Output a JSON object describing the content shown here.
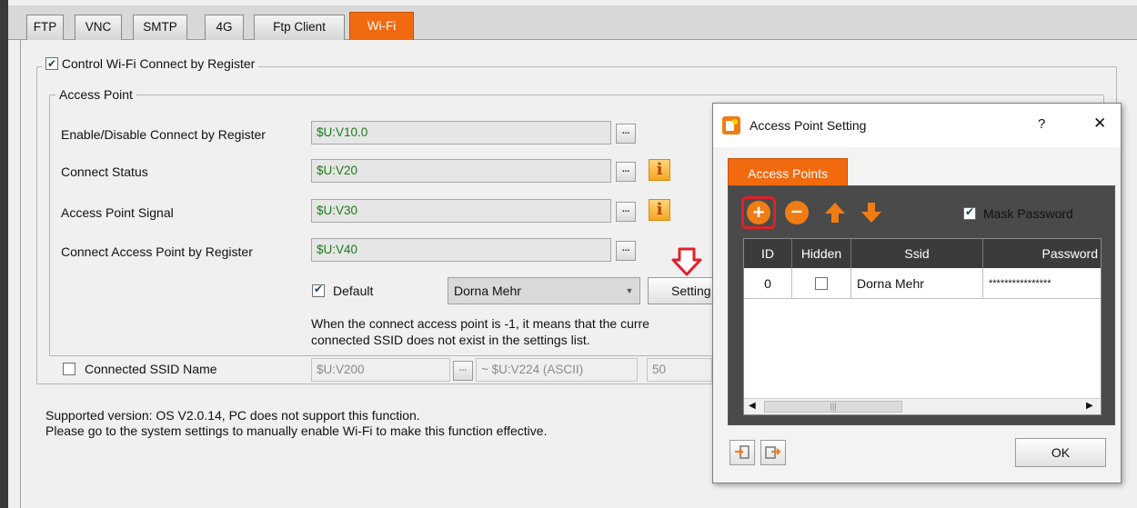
{
  "tabs": [
    "FTP",
    "VNC",
    "SMTP",
    "4G",
    "Ftp Client",
    "Wi-Fi"
  ],
  "active_tab": "Wi-Fi",
  "control_group": {
    "label": "Control Wi-Fi Connect by Register",
    "checked": true
  },
  "access_point_group": {
    "label": "Access Point",
    "rows": [
      {
        "label": "Enable/Disable Connect by Register",
        "value": "$U:V10.0",
        "dots": "...",
        "info": false
      },
      {
        "label": "Connect Status",
        "value": "$U:V20",
        "dots": "...",
        "info": true
      },
      {
        "label": "Access Point Signal",
        "value": "$U:V30",
        "dots": "...",
        "info": true
      },
      {
        "label": "Connect Access Point by Register",
        "value": "$U:V40",
        "dots": "...",
        "info": false
      }
    ],
    "info_glyph": "i",
    "default_label": "Default",
    "default_checked": true,
    "default_select": "Dorna Mehr",
    "settings_button": "Setting",
    "note_line1": "When the connect access point is -1, it means that the curre",
    "note_line2": "connected SSID does not exist in the settings list."
  },
  "connected_ssid": {
    "label": "Connected SSID Name",
    "checked": false,
    "value": "$U:V200",
    "dots": "...",
    "range": "~ $U:V224 (ASCII)",
    "length": "50"
  },
  "footer": {
    "line1": "Supported version: OS V2.0.14, PC does not support this function.",
    "line2": "Please go to the system settings to manually enable Wi-Fi to make this function effective."
  },
  "dialog": {
    "title": "Access Point Setting",
    "help": "?",
    "close": "✕",
    "tab": "Access Points",
    "mask_password_label": "Mask Password",
    "mask_password_checked": true,
    "columns": [
      "ID",
      "Hidden",
      "Ssid",
      "Password"
    ],
    "rows": [
      {
        "id": "0",
        "hidden": false,
        "ssid": "Dorna Mehr",
        "password": "****************"
      }
    ],
    "ok_label": "OK"
  },
  "colors": {
    "accent": "#f26a10",
    "highlight": "#e0202a",
    "value_text": "#1a7a1a"
  }
}
